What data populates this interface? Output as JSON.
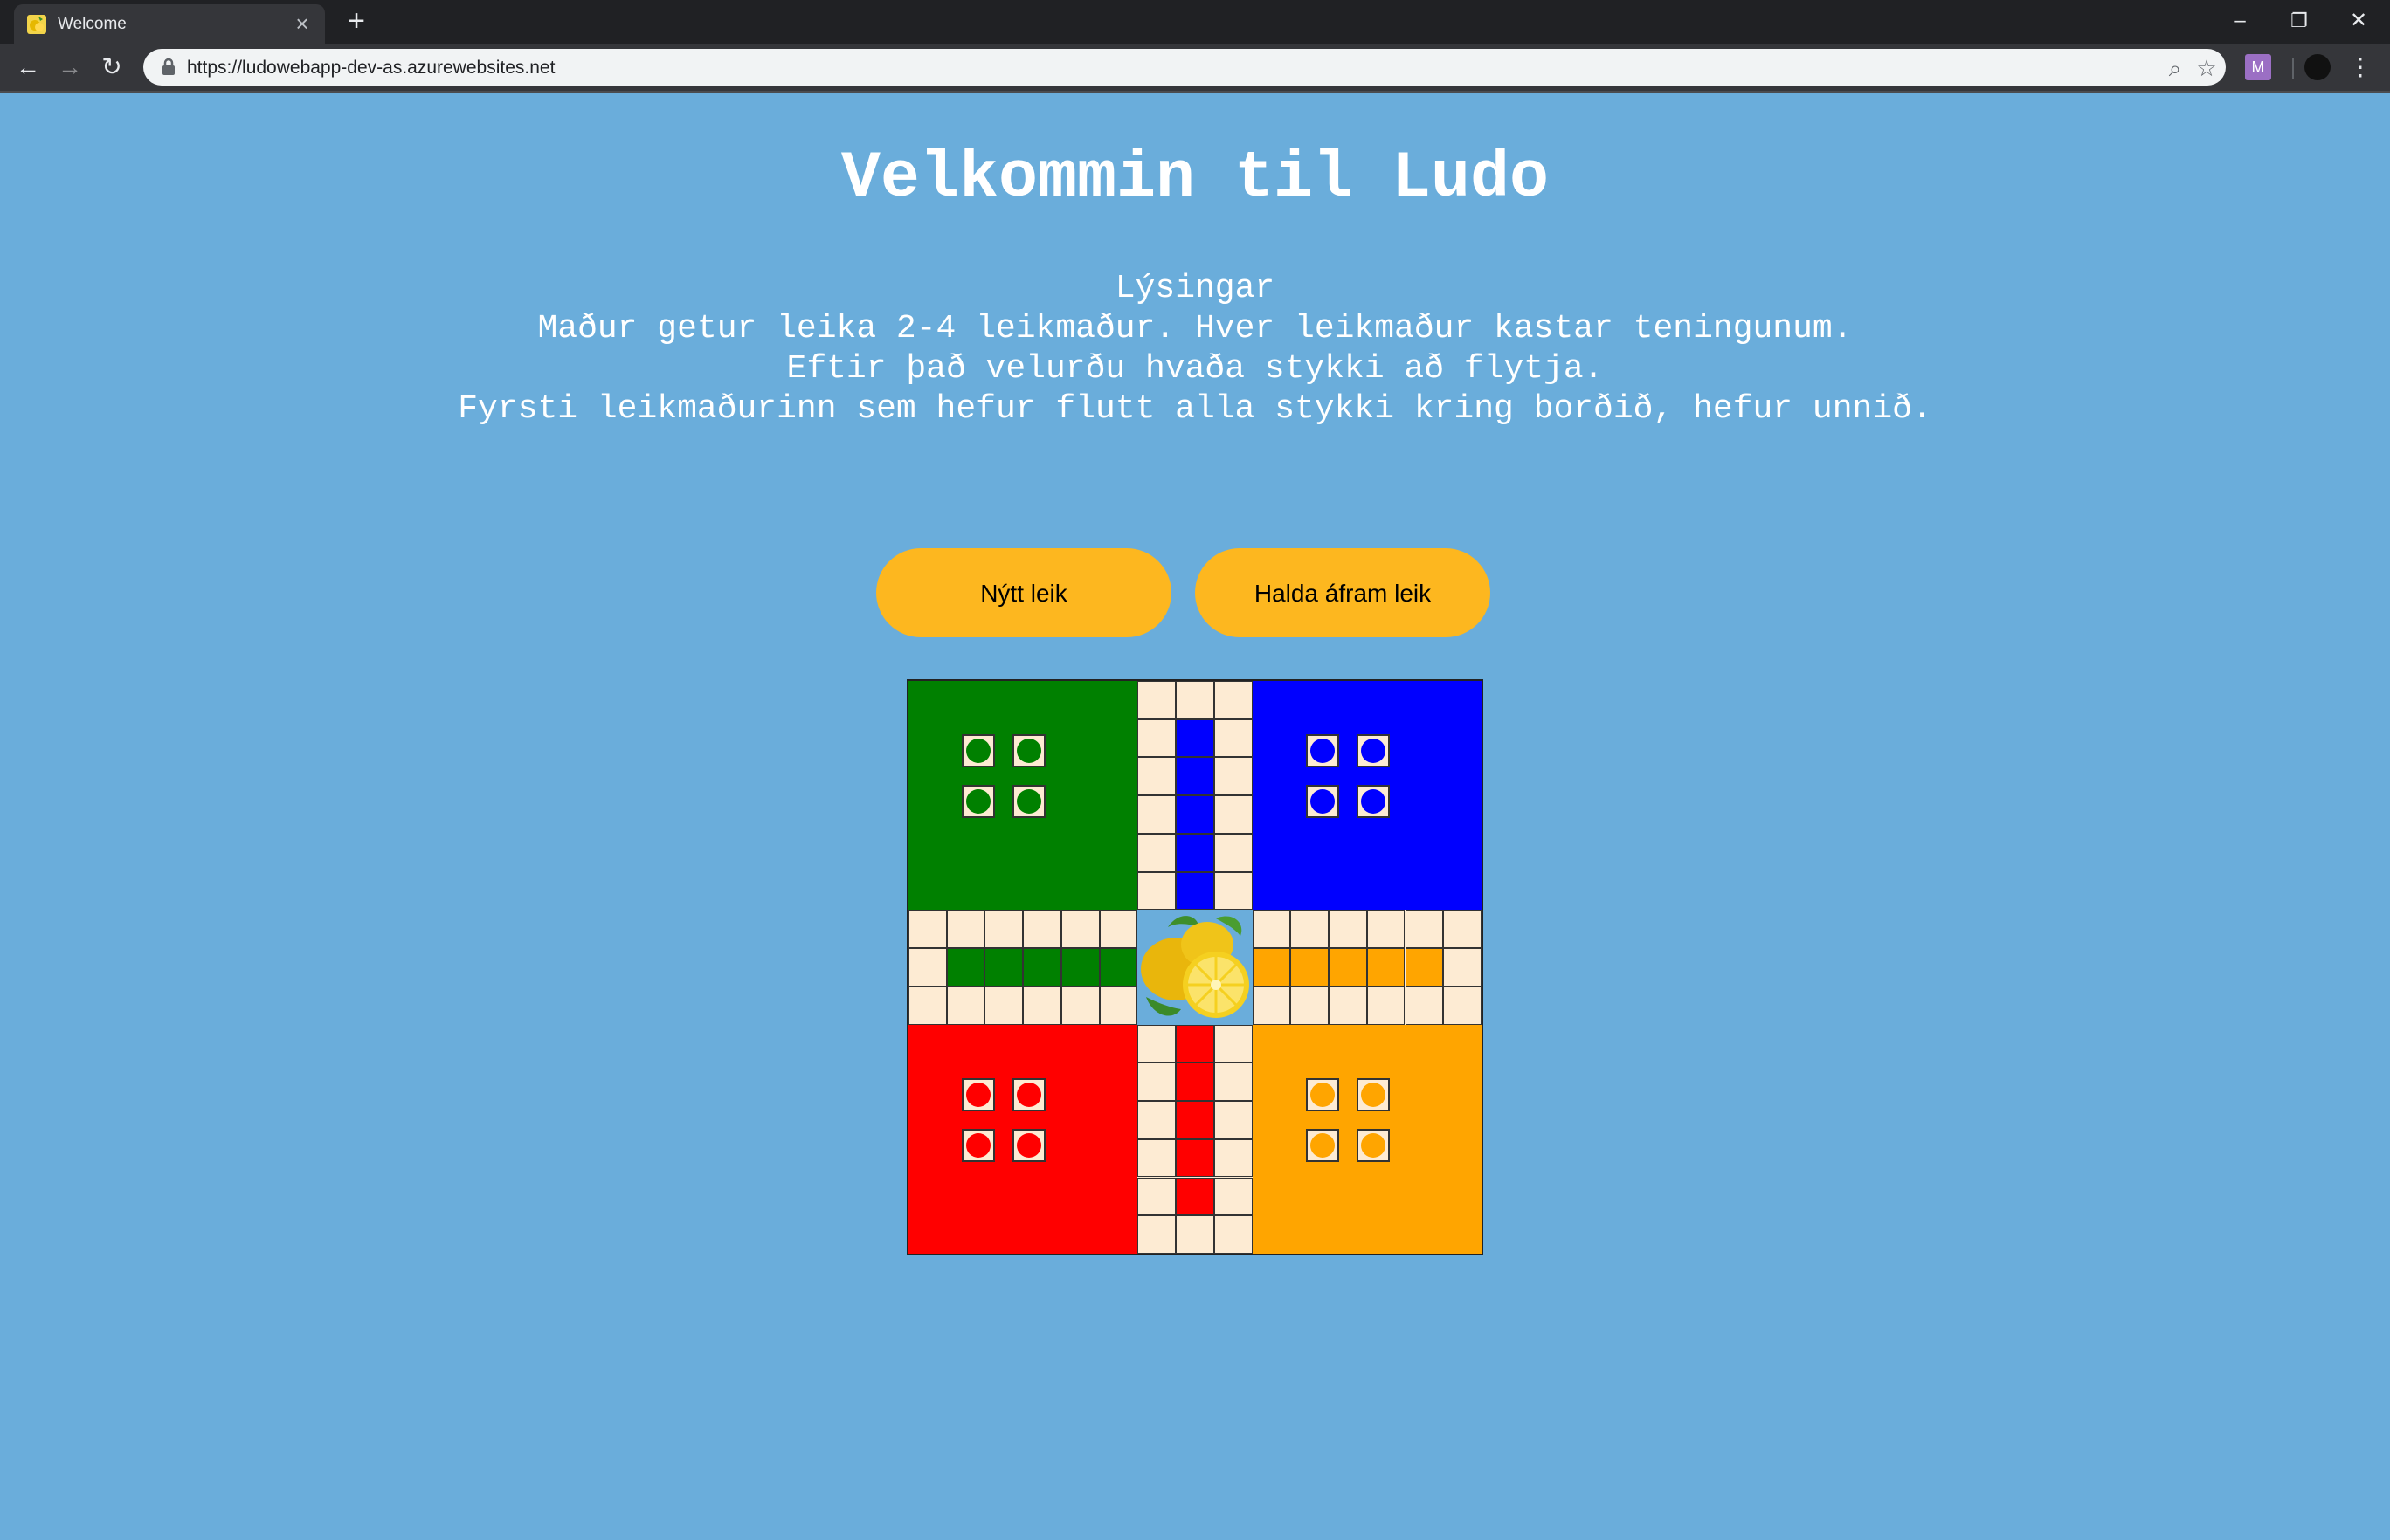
{
  "browser": {
    "tab_title": "Welcome",
    "new_tab_label": "+",
    "url": "https://ludowebapp-dev-as.azurewebsites.net",
    "window": {
      "minimize": "–",
      "restore": "❐",
      "close": "✕"
    },
    "tab_close": "×",
    "nav": {
      "back": "←",
      "forward": "→",
      "reload": "↻"
    },
    "zoom_icon": "⌕",
    "star_icon": "☆",
    "menu_icon": "⋮",
    "ext_letter": "M"
  },
  "page": {
    "title": "Velkommin til Ludo",
    "instructions": [
      "Lýsingar",
      "Maður getur leika 2-4 leikmaður. Hver leikmaður kastar teningunum.",
      "Eftir það velurðu hvaða stykki að flytja.",
      "Fyrsti leikmaðurinn sem hefur flutt alla stykki kring borðið, hefur unnið."
    ],
    "buttons": {
      "new_game": "Nýtt leik",
      "continue_game": "Halda áfram leik"
    }
  },
  "board": {
    "players": [
      {
        "name": "green",
        "color": "#008000"
      },
      {
        "name": "blue",
        "color": "#0000ff"
      },
      {
        "name": "red",
        "color": "#ff0000"
      },
      {
        "name": "orange",
        "color": "#ffa500"
      }
    ],
    "cell_color": "#fdebd3",
    "center_icon": "lemons-icon"
  }
}
